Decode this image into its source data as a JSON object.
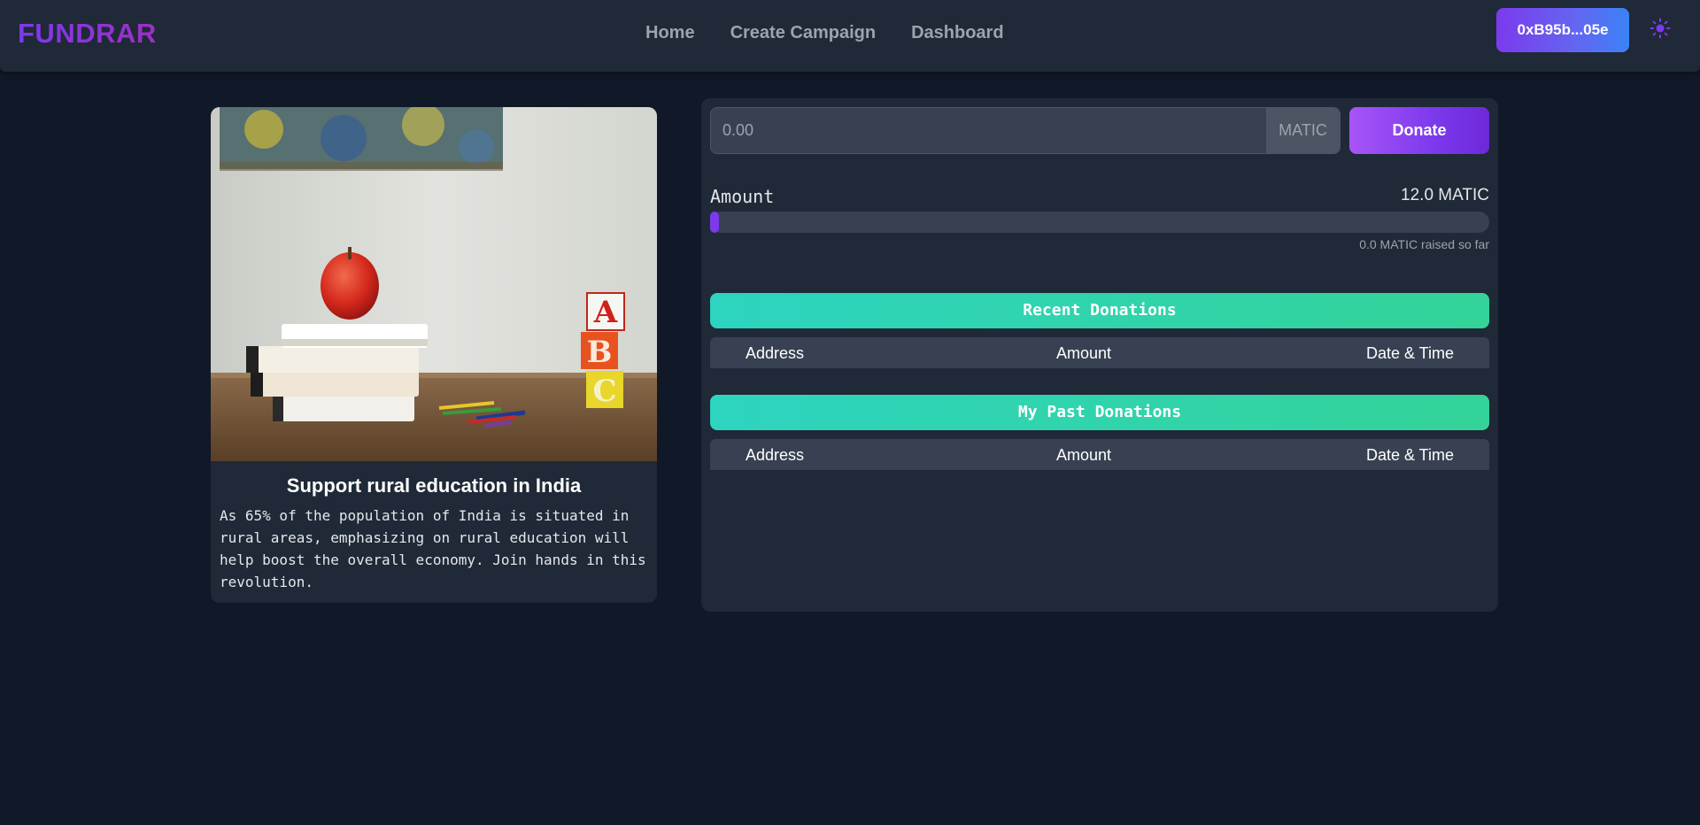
{
  "brand": {
    "name": "FUNDRAR"
  },
  "nav": {
    "links": [
      {
        "label": "Home"
      },
      {
        "label": "Create Campaign"
      },
      {
        "label": "Dashboard"
      }
    ],
    "wallet_label": "0xB95b...05e",
    "theme_icon": "sun-icon"
  },
  "campaign": {
    "image_icon": "education-scene-image",
    "title": "Support rural education in India",
    "description": "As 65% of the population of India is situated in rural areas, emphasizing on rural education will help boost the overall economy. Join hands in this revolution."
  },
  "donate": {
    "placeholder": "0.00",
    "currency": "MATIC",
    "button_label": "Donate",
    "goal_label": "Amount",
    "goal_value": "12.0 MATIC",
    "progress_fraction": 0,
    "raised_text": "0.0 MATIC raised so far"
  },
  "recent_donations": {
    "title": "Recent Donations",
    "columns": [
      "Address",
      "Amount",
      "Date & Time"
    ],
    "rows": []
  },
  "past_donations": {
    "title": "My Past Donations",
    "columns": [
      "Address",
      "Amount",
      "Date & Time"
    ],
    "rows": []
  },
  "colors": {
    "background": "#111827",
    "surface": "#1f2937",
    "accent_purple": "#7c3aed",
    "accent_teal": "#2dd4bf"
  }
}
